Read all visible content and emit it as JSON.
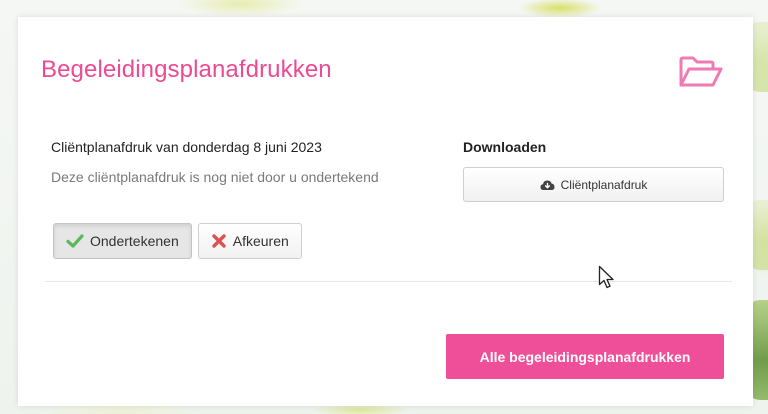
{
  "card": {
    "title": "Begeleidingsplanafdrukken",
    "header_icon": "folder-open-icon"
  },
  "plan": {
    "title": "Cliëntplanafdruk van donderdag 8 juni 2023",
    "note": "Deze cliëntplanafdruk is nog niet door u ondertekend"
  },
  "actions": {
    "sign_label": "Ondertekenen",
    "sign_icon": "check-icon",
    "reject_label": "Afkeuren",
    "reject_icon": "x-icon"
  },
  "download": {
    "heading": "Downloaden",
    "button_label": "Cliëntplanafdruk",
    "button_icon": "cloud-download-icon"
  },
  "footer": {
    "all_button_label": "Alle begeleidingsplanafdrukken"
  },
  "colors": {
    "accent": "#ec4a93",
    "accent_button": "#ef4f98",
    "check": "#5cb85c",
    "reject": "#d9534f"
  }
}
